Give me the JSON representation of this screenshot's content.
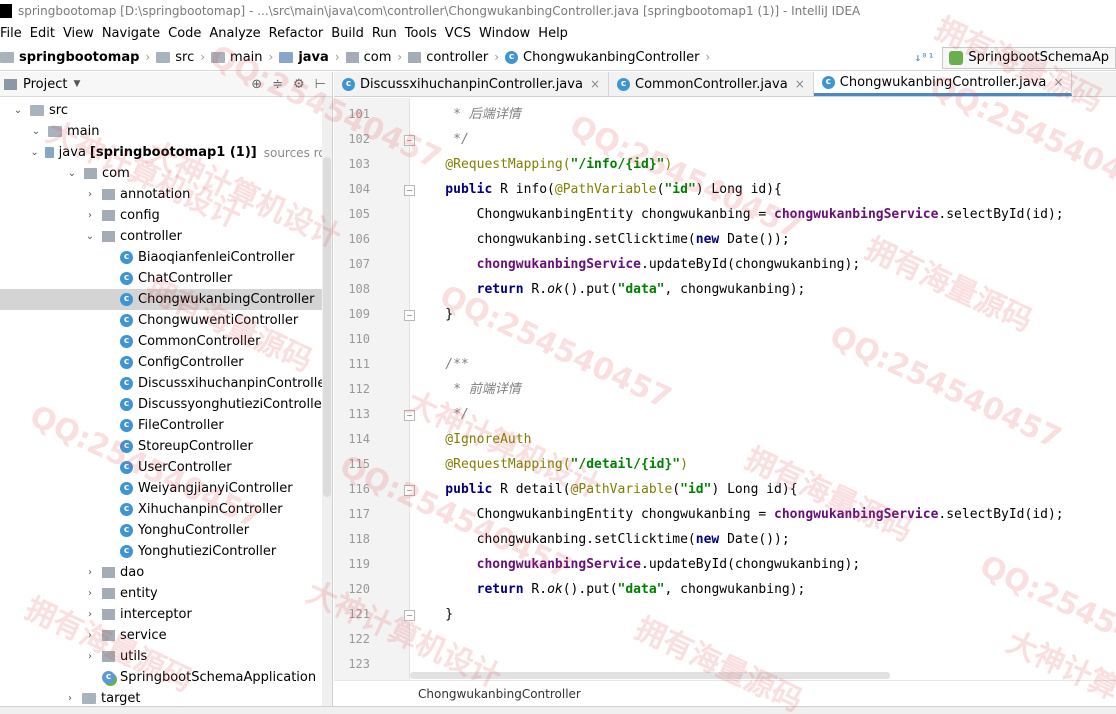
{
  "window": {
    "title": "springbootomap [D:\\springbootomap] - ...\\src\\main\\java\\com\\controller\\ChongwukanbingController.java [springbootomap1 (1)] - IntelliJ IDEA"
  },
  "menu": [
    "File",
    "Edit",
    "View",
    "Navigate",
    "Code",
    "Analyze",
    "Refactor",
    "Build",
    "Run",
    "Tools",
    "VCS",
    "Window",
    "Help"
  ],
  "navbar": {
    "crumbs": [
      "springbootomap",
      "src",
      "main",
      "java",
      "com",
      "controller",
      "ChongwukanbingController"
    ],
    "run_config": "SpringbootSchemaAp"
  },
  "project_panel": {
    "title": "Project",
    "items": [
      {
        "label": "src",
        "arrow": "down",
        "icon": "folder"
      },
      {
        "label": "main",
        "arrow": "down",
        "icon": "folder"
      },
      {
        "label": "java",
        "bold": "[springbootomap1 (1)]",
        "hint": "sources roo",
        "arrow": "down",
        "icon": "folder-blue"
      },
      {
        "label": "com",
        "arrow": "down",
        "icon": "package"
      },
      {
        "label": "annotation",
        "arrow": "right",
        "icon": "package"
      },
      {
        "label": "config",
        "arrow": "right",
        "icon": "package"
      },
      {
        "label": "controller",
        "arrow": "down",
        "icon": "package"
      },
      {
        "label": "BiaoqianfenleiController",
        "icon": "class"
      },
      {
        "label": "ChatController",
        "icon": "class"
      },
      {
        "label": "ChongwukanbingController",
        "icon": "class",
        "selected": true
      },
      {
        "label": "ChongwuwentiController",
        "icon": "class"
      },
      {
        "label": "CommonController",
        "icon": "class"
      },
      {
        "label": "ConfigController",
        "icon": "class"
      },
      {
        "label": "DiscussxihuchanpinController",
        "icon": "class"
      },
      {
        "label": "DiscussyonghutieziController",
        "icon": "class"
      },
      {
        "label": "FileController",
        "icon": "class"
      },
      {
        "label": "StoreupController",
        "icon": "class"
      },
      {
        "label": "UserController",
        "icon": "class"
      },
      {
        "label": "WeiyangjianyiController",
        "icon": "class"
      },
      {
        "label": "XihuchanpinController",
        "icon": "class"
      },
      {
        "label": "YonghuController",
        "icon": "class"
      },
      {
        "label": "YonghutieziController",
        "icon": "class"
      },
      {
        "label": "dao",
        "arrow": "right",
        "icon": "package"
      },
      {
        "label": "entity",
        "arrow": "right",
        "icon": "package"
      },
      {
        "label": "interceptor",
        "arrow": "right",
        "icon": "package"
      },
      {
        "label": "service",
        "arrow": "right",
        "icon": "package"
      },
      {
        "label": "utils",
        "arrow": "right",
        "icon": "package"
      },
      {
        "label": "SpringbootSchemaApplication",
        "icon": "spring-class"
      },
      {
        "label": "target",
        "arrow": "right",
        "icon": "folder"
      }
    ]
  },
  "tabs": [
    {
      "label": "DiscussxihuchanpinController.java",
      "active": false
    },
    {
      "label": "CommonController.java",
      "active": false
    },
    {
      "label": "ChongwukanbingController.java",
      "active": true
    }
  ],
  "editor": {
    "line_numbers": [
      "101",
      "102",
      "103",
      "104",
      "105",
      "106",
      "107",
      "108",
      "109",
      "110",
      "111",
      "112",
      "113",
      "114",
      "115",
      "116",
      "117",
      "118",
      "119",
      "120",
      "121",
      "122",
      "123"
    ],
    "lines": [
      [
        {
          "t": "     * 后端详情",
          "c": "cmt"
        }
      ],
      [
        {
          "t": "     */",
          "c": "cmt"
        }
      ],
      [
        {
          "t": "    @RequestMapping(",
          "c": "ann"
        },
        {
          "t": "\"/info/{id}\"",
          "c": "str"
        },
        {
          "t": ")",
          "c": "ann"
        }
      ],
      [
        {
          "t": "    public ",
          "c": "kw"
        },
        {
          "t": "R info("
        },
        {
          "t": "@PathVariable",
          "c": "ann"
        },
        {
          "t": "("
        },
        {
          "t": "\"id\"",
          "c": "str"
        },
        {
          "t": ") Long id){"
        }
      ],
      [
        {
          "t": "        ChongwukanbingEntity chongwukanbing = "
        },
        {
          "t": "chongwukanbingService",
          "c": "fld"
        },
        {
          "t": ".selectById(id);"
        }
      ],
      [
        {
          "t": "        chongwukanbing.setClicktime("
        },
        {
          "t": "new ",
          "c": "kw"
        },
        {
          "t": "Date());"
        }
      ],
      [
        {
          "t": "        "
        },
        {
          "t": "chongwukanbingService",
          "c": "fld"
        },
        {
          "t": ".updateById(chongwukanbing);"
        }
      ],
      [
        {
          "t": "        "
        },
        {
          "t": "return ",
          "c": "kw"
        },
        {
          "t": "R."
        },
        {
          "t": "ok",
          "c": "it"
        },
        {
          "t": "().put("
        },
        {
          "t": "\"data\"",
          "c": "str"
        },
        {
          "t": ", chongwukanbing);"
        }
      ],
      [
        {
          "t": "    }"
        }
      ],
      [
        {
          "t": ""
        }
      ],
      [
        {
          "t": "    /**",
          "c": "cmt"
        }
      ],
      [
        {
          "t": "     * 前端详情",
          "c": "cmt"
        }
      ],
      [
        {
          "t": "     */",
          "c": "cmt"
        }
      ],
      [
        {
          "t": "    @IgnoreAuth",
          "c": "ann"
        }
      ],
      [
        {
          "t": "    @RequestMapping(",
          "c": "ann"
        },
        {
          "t": "\"/detail/{id}\"",
          "c": "str"
        },
        {
          "t": ")",
          "c": "ann"
        }
      ],
      [
        {
          "t": "    public ",
          "c": "kw"
        },
        {
          "t": "R detail("
        },
        {
          "t": "@PathVariable",
          "c": "ann"
        },
        {
          "t": "("
        },
        {
          "t": "\"id\"",
          "c": "str"
        },
        {
          "t": ") Long id){"
        }
      ],
      [
        {
          "t": "        ChongwukanbingEntity chongwukanbing = "
        },
        {
          "t": "chongwukanbingService",
          "c": "fld"
        },
        {
          "t": ".selectById(id);"
        }
      ],
      [
        {
          "t": "        chongwukanbing.setClicktime("
        },
        {
          "t": "new ",
          "c": "kw"
        },
        {
          "t": "Date());"
        }
      ],
      [
        {
          "t": "        "
        },
        {
          "t": "chongwukanbingService",
          "c": "fld"
        },
        {
          "t": ".updateById(chongwukanbing);"
        }
      ],
      [
        {
          "t": "        "
        },
        {
          "t": "return ",
          "c": "kw"
        },
        {
          "t": "R."
        },
        {
          "t": "ok",
          "c": "it"
        },
        {
          "t": "().put("
        },
        {
          "t": "\"data\"",
          "c": "str"
        },
        {
          "t": ", chongwukanbing);"
        }
      ],
      [
        {
          "t": "    }"
        }
      ],
      [
        {
          "t": ""
        }
      ],
      [
        {
          "t": ""
        }
      ]
    ],
    "bottom_breadcrumb": "ChongwukanbingController"
  },
  "watermarks": [
    "拥有海量源码",
    "QQ:254540457",
    "大神计算机设计"
  ]
}
